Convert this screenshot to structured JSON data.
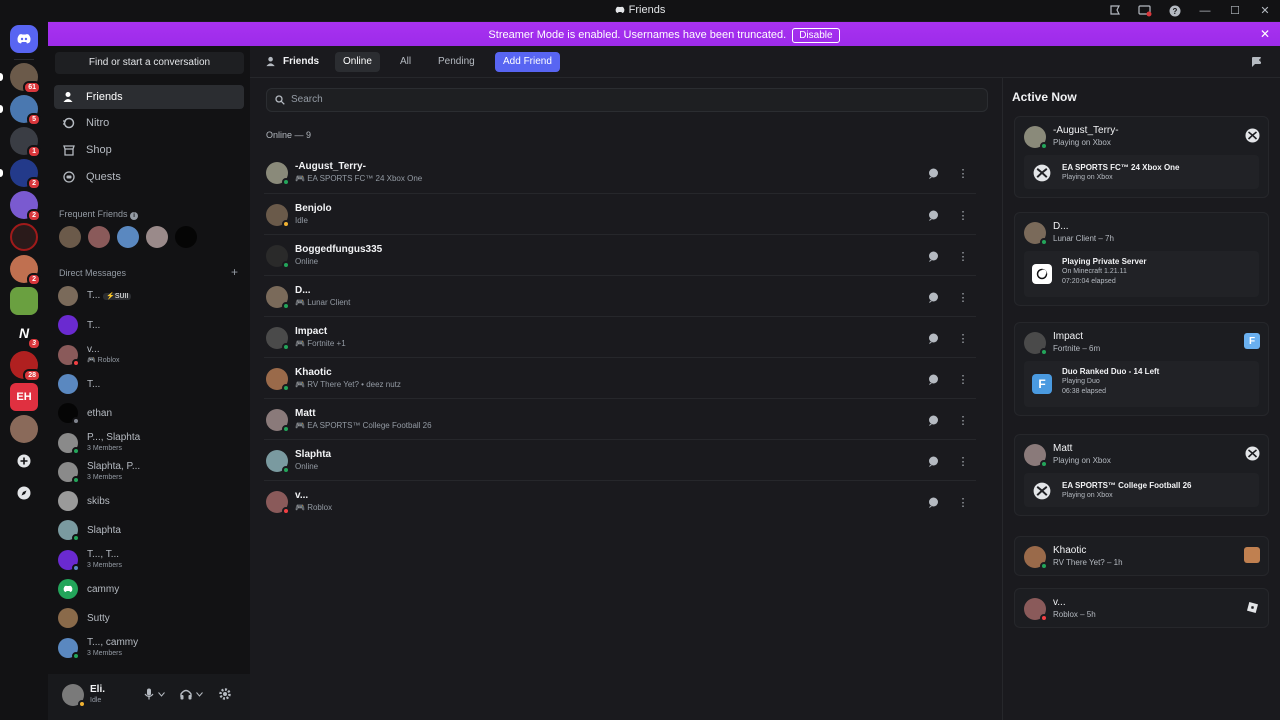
{
  "window": {
    "title": "Friends"
  },
  "banner": {
    "text": "Streamer Mode is enabled. Usernames have been truncated.",
    "button": "Disable"
  },
  "servers": [
    {
      "badge": "61"
    },
    {
      "badge": "5"
    },
    {
      "badge": "1"
    },
    {
      "badge": "2"
    },
    {
      "badge": "2"
    },
    {
      "badge": ""
    },
    {
      "badge": "2"
    },
    {
      "badge": ""
    },
    {
      "badge": "3"
    },
    {
      "badge": "28"
    },
    {
      "badge": ""
    },
    {
      "badge": ""
    }
  ],
  "sidebar": {
    "find": "Find or start a conversation",
    "nav": [
      {
        "label": "Friends",
        "icon": "person-wave-icon"
      },
      {
        "label": "Nitro",
        "icon": "nitro-icon"
      },
      {
        "label": "Shop",
        "icon": "shop-icon"
      },
      {
        "label": "Quests",
        "icon": "quests-icon"
      }
    ],
    "frequent_label": "Frequent Friends",
    "dm_label": "Direct Messages",
    "dms": [
      {
        "name": "T...",
        "tag": "⚡SUII",
        "sub": ""
      },
      {
        "name": "T...",
        "tag": "",
        "sub": ""
      },
      {
        "name": "v...",
        "tag": "",
        "sub": "Roblox"
      },
      {
        "name": "T...",
        "tag": "",
        "sub": ""
      },
      {
        "name": "ethan",
        "tag": "",
        "sub": ""
      },
      {
        "name": "P..., Slaphta",
        "tag": "",
        "sub": "3 Members"
      },
      {
        "name": "Slaphta, P...",
        "tag": "",
        "sub": "3 Members"
      },
      {
        "name": "skibs",
        "tag": "",
        "sub": ""
      },
      {
        "name": "Slaphta",
        "tag": "",
        "sub": ""
      },
      {
        "name": "T..., T...",
        "tag": "",
        "sub": "3 Members"
      },
      {
        "name": "cammy",
        "tag": "",
        "sub": ""
      },
      {
        "name": "Sutty",
        "tag": "",
        "sub": ""
      },
      {
        "name": "T..., cammy",
        "tag": "",
        "sub": "3 Members"
      }
    ],
    "user": {
      "name": "Eli.",
      "status": "Idle"
    }
  },
  "main": {
    "tabs": {
      "friends": "Friends",
      "online": "Online",
      "all": "All",
      "pending": "Pending",
      "add": "Add Friend"
    },
    "search_placeholder": "Search",
    "online_header": "Online — 9",
    "friends": [
      {
        "name": "-August_Terry-",
        "sub": "EA SPORTS FC™ 24 Xbox One",
        "game": true
      },
      {
        "name": "Benjolo",
        "sub": "Idle",
        "game": false
      },
      {
        "name": "Boggedfungus335",
        "sub": "Online",
        "game": false
      },
      {
        "name": "D...",
        "sub": "Lunar Client",
        "game": true
      },
      {
        "name": "Impact",
        "sub": "Fortnite +1",
        "game": true
      },
      {
        "name": "Khaotic",
        "sub": "RV There Yet? • deez nutz",
        "game": true
      },
      {
        "name": "Matt",
        "sub": "EA SPORTS™ College Football 26",
        "game": true
      },
      {
        "name": "Slaphta",
        "sub": "Online",
        "game": false
      },
      {
        "name": "v...",
        "sub": "Roblox",
        "game": true
      }
    ]
  },
  "active_now": {
    "title": "Active Now",
    "cards": [
      {
        "name": "-August_Terry-",
        "sub": "Playing on Xbox",
        "t1": "EA SPORTS FC™ 24 Xbox One",
        "t2": "Playing on Xbox",
        "t3": ""
      },
      {
        "name": "D...",
        "sub": "Lunar Client – 7h",
        "t1": "Playing Private Server",
        "t2": "On Minecraft 1.21.11",
        "t3": "07:20:04 elapsed"
      },
      {
        "name": "Impact",
        "sub": "Fortnite – 6m",
        "t1": "Duo Ranked Duo - 14 Left",
        "t2": "Playing Duo",
        "t3": "06:38 elapsed"
      },
      {
        "name": "Matt",
        "sub": "Playing on Xbox",
        "t1": "EA SPORTS™ College Football 26",
        "t2": "Playing on Xbox",
        "t3": ""
      },
      {
        "name": "Khaotic",
        "sub": "RV There Yet? – 1h",
        "t1": "",
        "t2": "",
        "t3": ""
      },
      {
        "name": "v...",
        "sub": "Roblox – 5h",
        "t1": "",
        "t2": "",
        "t3": ""
      }
    ]
  },
  "colors": {
    "accent": "#5865f2",
    "online": "#23a55a",
    "idle": "#f0b232",
    "dnd": "#f23f43",
    "banner": "#a832f0"
  }
}
